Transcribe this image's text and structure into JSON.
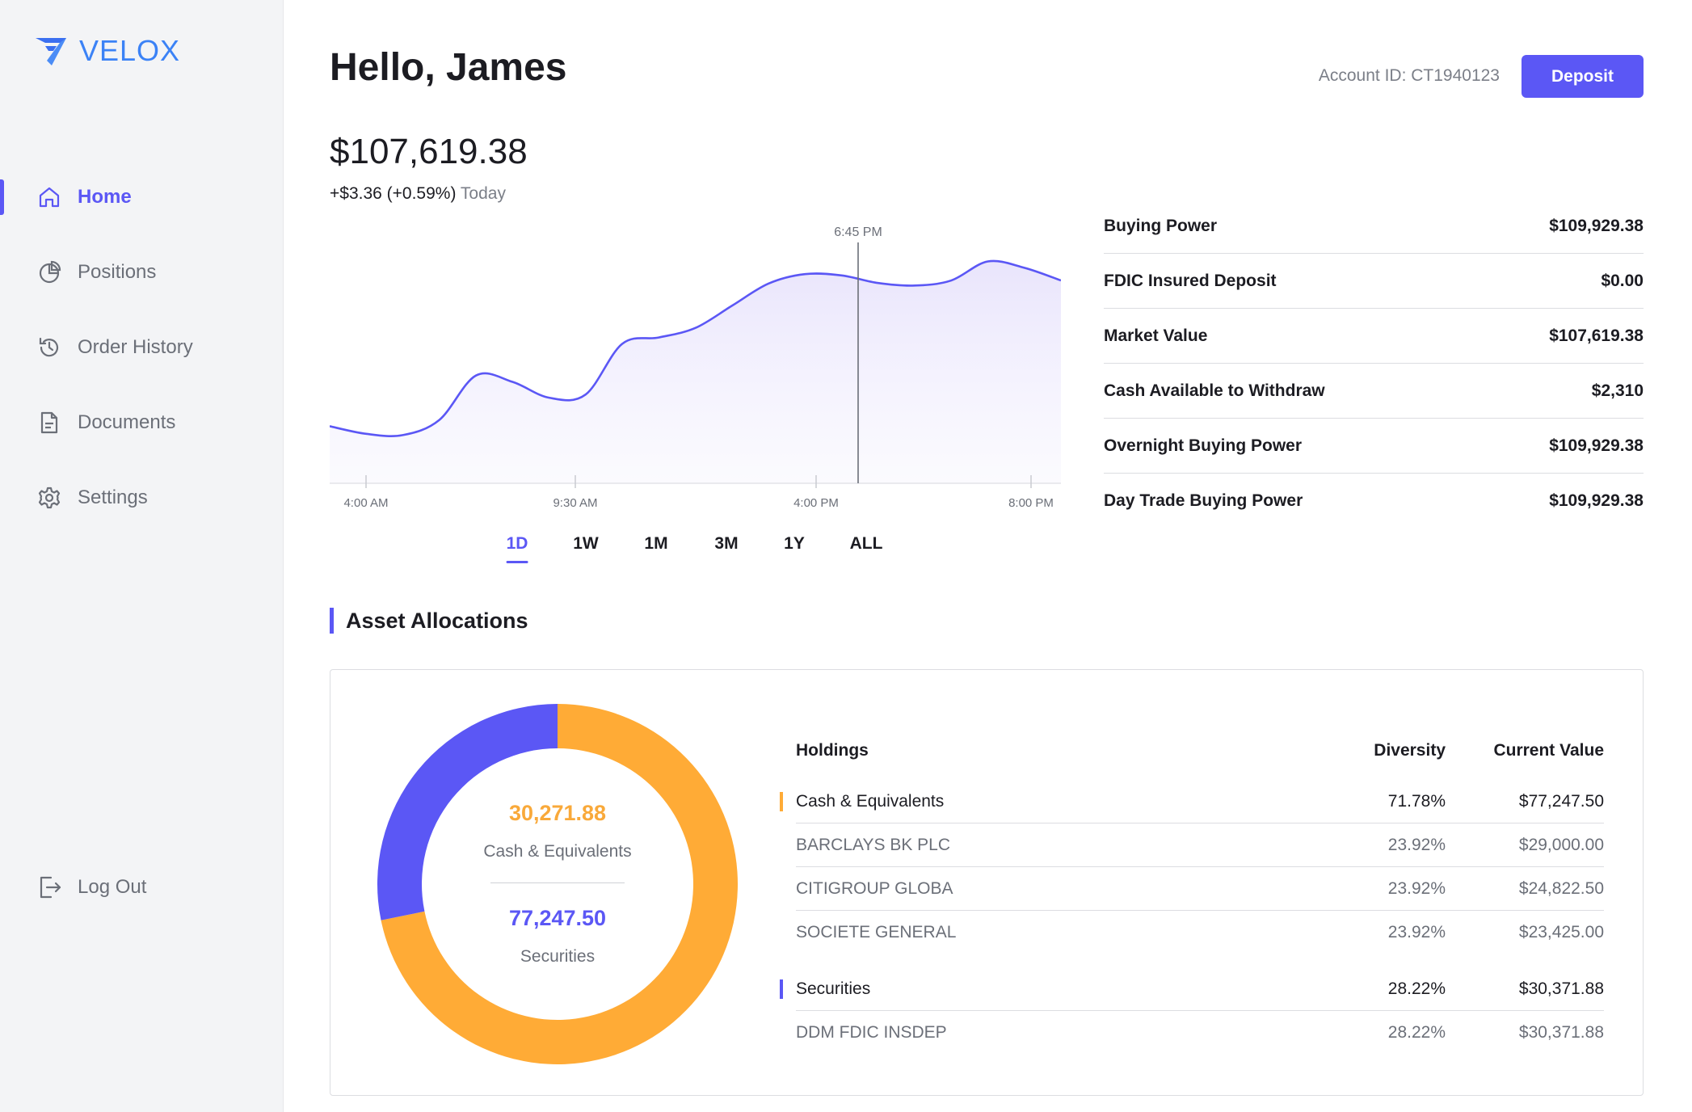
{
  "brand": {
    "name": "VELOX",
    "color": "#3b82f6"
  },
  "sidebar": {
    "items": [
      {
        "label": "Home",
        "icon": "home-icon",
        "active": true
      },
      {
        "label": "Positions",
        "icon": "pie-chart-icon",
        "active": false
      },
      {
        "label": "Order History",
        "icon": "history-icon",
        "active": false
      },
      {
        "label": "Documents",
        "icon": "document-icon",
        "active": false
      },
      {
        "label": "Settings",
        "icon": "gear-icon",
        "active": false
      }
    ],
    "logout": {
      "label": "Log Out",
      "icon": "logout-icon"
    }
  },
  "header": {
    "greeting": "Hello, James",
    "account_id": "Account ID: CT1940123",
    "deposit_label": "Deposit"
  },
  "portfolio": {
    "balance": "$107,619.38",
    "change": "+$3.36 (+0.59%)",
    "change_period": "Today"
  },
  "chart_data": {
    "type": "area",
    "x_ticks": [
      "4:00 AM",
      "9:30 AM",
      "4:00 PM",
      "8:00 PM"
    ],
    "cursor_label": "6:45 PM",
    "series": [
      {
        "values": [
          107350,
          107338,
          107336,
          107360,
          107430,
          107420,
          107395,
          107400,
          107480,
          107490,
          107505,
          107540,
          107575,
          107590,
          107588,
          107576,
          107572,
          107580,
          107610,
          107600,
          107580
        ]
      }
    ],
    "ylim": [
      107260,
      107640
    ],
    "grid": false,
    "line_color": "#5b57f5",
    "fill_color": "#ece9fd"
  },
  "ranges": [
    "1D",
    "1W",
    "1M",
    "3M",
    "1Y",
    "ALL"
  ],
  "active_range": "1D",
  "stats": [
    {
      "label": "Buying Power",
      "value": "$109,929.38"
    },
    {
      "label": "FDIC Insured Deposit",
      "value": "$0.00"
    },
    {
      "label": "Market Value",
      "value": "$107,619.38"
    },
    {
      "label": "Cash Available to Withdraw",
      "value": "$2,310"
    },
    {
      "label": "Overnight Buying Power",
      "value": "$109,929.38"
    },
    {
      "label": "Day Trade Buying Power",
      "value": "$109,929.38"
    }
  ],
  "allocations": {
    "title": "Asset Allocations",
    "donut": {
      "segments": [
        {
          "name": "Cash & Equivalents",
          "percent": 71.78,
          "color": "#ffab36"
        },
        {
          "name": "Securities",
          "percent": 28.22,
          "color": "#5b57f5"
        }
      ],
      "value1": "30,271.88",
      "label1": "Cash & Equivalents",
      "value2": "77,247.50",
      "label2": "Securities",
      "value1_color": "#f9a93a",
      "value2_color": "#5b57f5"
    },
    "headers": {
      "name": "Holdings",
      "diversity": "Diversity",
      "value": "Current Value"
    },
    "groups": [
      {
        "name": "Cash & Equivalents",
        "diversity": "71.78%",
        "value": "$77,247.50",
        "color": "#ffab36",
        "rows": [
          {
            "name": "BARCLAYS BK PLC",
            "diversity": "23.92%",
            "value": "$29,000.00"
          },
          {
            "name": "CITIGROUP GLOBA",
            "diversity": "23.92%",
            "value": "$24,822.50"
          },
          {
            "name": "SOCIETE GENERAL",
            "diversity": "23.92%",
            "value": "$23,425.00"
          }
        ]
      },
      {
        "name": "Securities",
        "diversity": "28.22%",
        "value": "$30,371.88",
        "color": "#5b57f5",
        "rows": [
          {
            "name": "DDM FDIC INSDEP",
            "diversity": "28.22%",
            "value": "$30,371.88"
          }
        ]
      }
    ]
  }
}
